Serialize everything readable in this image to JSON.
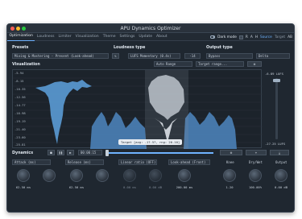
{
  "window": {
    "title": "APU Dynamics Optimizer"
  },
  "menu": {
    "tabs": [
      "Optimization",
      "Loudness",
      "Limiter",
      "Visualization",
      "Theme",
      "Settings",
      "Update",
      "About"
    ],
    "dark_mode_label": "Dark mode",
    "chips": [
      "R",
      "A",
      "H"
    ],
    "source_label": "Source",
    "target_label": "Target",
    "last_label": "AB"
  },
  "presets": {
    "label": "Presets",
    "value": "Mixing & Mastering - Present (Look-ahead)"
  },
  "loudness": {
    "label": "Loudness type",
    "value": "LUFS Momentary (0.4s)",
    "number": "-14"
  },
  "output": {
    "label": "Output type",
    "value": "Bypass",
    "extra": "Delta"
  },
  "visualization": {
    "label": "Visualization",
    "auto_range": "Auto Range",
    "target_range": "Target range...",
    "y_ticks": [
      "-5.94",
      "-8.15",
      "-10.35",
      "-12.56",
      "-14.77",
      "-16.98",
      "-19.19",
      "-21.40",
      "-23.60",
      "-25.81"
    ],
    "right_top": "-6.89 LUFS",
    "right_bottom": "-27.25 LUFS",
    "tooltip": "Target [avg: -17.57, rng: 20.10]"
  },
  "dynamics": {
    "label": "Dynamics",
    "time": "00:00:15"
  },
  "controls": {
    "attack": {
      "label": "Attack (ms)",
      "value": "62.50 ms"
    },
    "release": {
      "label": "Release (ms)",
      "value": "62.50 ms"
    },
    "linear_ratio": {
      "label": "Linear ratio (OFF)",
      "value": "0.00 ms"
    },
    "lookahead": {
      "label": "Look-ahead (Front)",
      "value": "200.00 ms"
    },
    "knee": {
      "label": "Knee",
      "value": "1.20"
    },
    "drywet": {
      "label": "Dry/Wet",
      "value": "100.00%"
    },
    "output": {
      "label": "Output",
      "value": "0.00 dB"
    },
    "hidden_vals": [
      "0.00 dB",
      "0.00 dB"
    ]
  },
  "colors": {
    "accent": "#6fb3ff",
    "bg": "#1f2730",
    "wave": "#5b9bd5"
  }
}
